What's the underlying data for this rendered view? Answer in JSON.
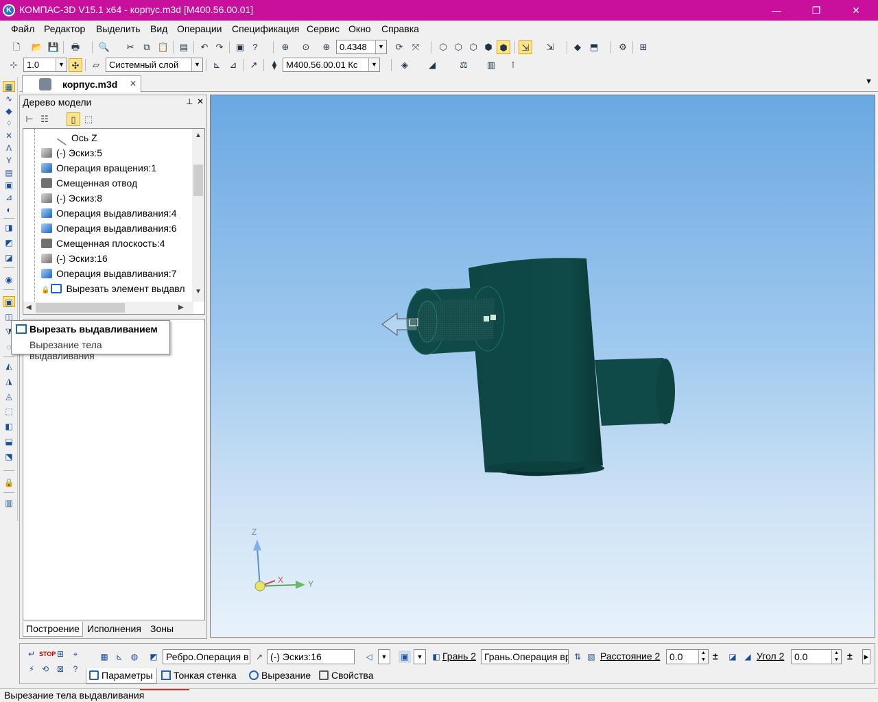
{
  "window": {
    "title": "КОМПАС-3D V15.1 x64 - корпус.m3d [M400.56.00.01]",
    "app_icon": "K",
    "minimize": "—",
    "maximize": "❐",
    "close": "✕"
  },
  "menu": [
    "Файл",
    "Редактор",
    "Выделить",
    "Вид",
    "Операции",
    "Спецификация",
    "Сервис",
    "Окно",
    "Справка"
  ],
  "toolbar1": {
    "zoom_value": "0.4348"
  },
  "toolbar2": {
    "step_value": "1.0",
    "layer": "Системный слой",
    "designation": "M400.56.00.01 Кс"
  },
  "doc_tab": {
    "label": "корпус.m3d",
    "close": "✕",
    "menu_arrow": "▼"
  },
  "tree_panel": {
    "title": "Дерево модели",
    "pin": "⊥",
    "close": "✕",
    "items": [
      {
        "label": "Ось Z",
        "icon": "axis-icon"
      },
      {
        "label": "(-) Эскиз:5",
        "icon": "sketch-icon"
      },
      {
        "label": "Операция вращения:1",
        "icon": "rotation-icon"
      },
      {
        "label": "Смещенная отвод",
        "icon": "plane-icon"
      },
      {
        "label": "(-) Эскиз:8",
        "icon": "sketch-icon"
      },
      {
        "label": "Операция выдавливания:4",
        "icon": "extrude-icon"
      },
      {
        "label": "Операция выдавливания:6",
        "icon": "extrude-icon"
      },
      {
        "label": "Смещенная плоскость:4",
        "icon": "plane-icon"
      },
      {
        "label": "(-) Эскиз:16",
        "icon": "sketch-icon"
      },
      {
        "label": "Операция выдавливания:7",
        "icon": "extrude-icon"
      },
      {
        "label": "Вырезать элемент выдавл",
        "icon": "cut-extrude-icon"
      }
    ],
    "tabs": [
      "Построение",
      "Исполнения",
      "Зоны"
    ]
  },
  "tooltip": {
    "title": "Вырезать выдавливанием",
    "description": "Вырезание тела выдавливания"
  },
  "viewport": {
    "axis_x": "X",
    "axis_y": "Y",
    "axis_z": "Z",
    "model_color": "#0f4a48",
    "background_top": "#6aa8e3",
    "background_bottom": "#e8f2fb"
  },
  "property_panel": {
    "edge_field": "Ребро.Операция в",
    "sketch_field": "(-) Эскиз:16",
    "face_label": "Грань 2",
    "face_field": "Грань.Операция вр",
    "distance_label": "Расстояние 2",
    "distance_value": "0.0",
    "angle_label": "Угол 2",
    "angle_value": "0.0",
    "plusminus": "±",
    "tabs": [
      "Параметры",
      "Тонкая стенка",
      "Вырезание",
      "Свойства"
    ]
  },
  "status": {
    "text": "Вырезание тела выдавливания"
  }
}
